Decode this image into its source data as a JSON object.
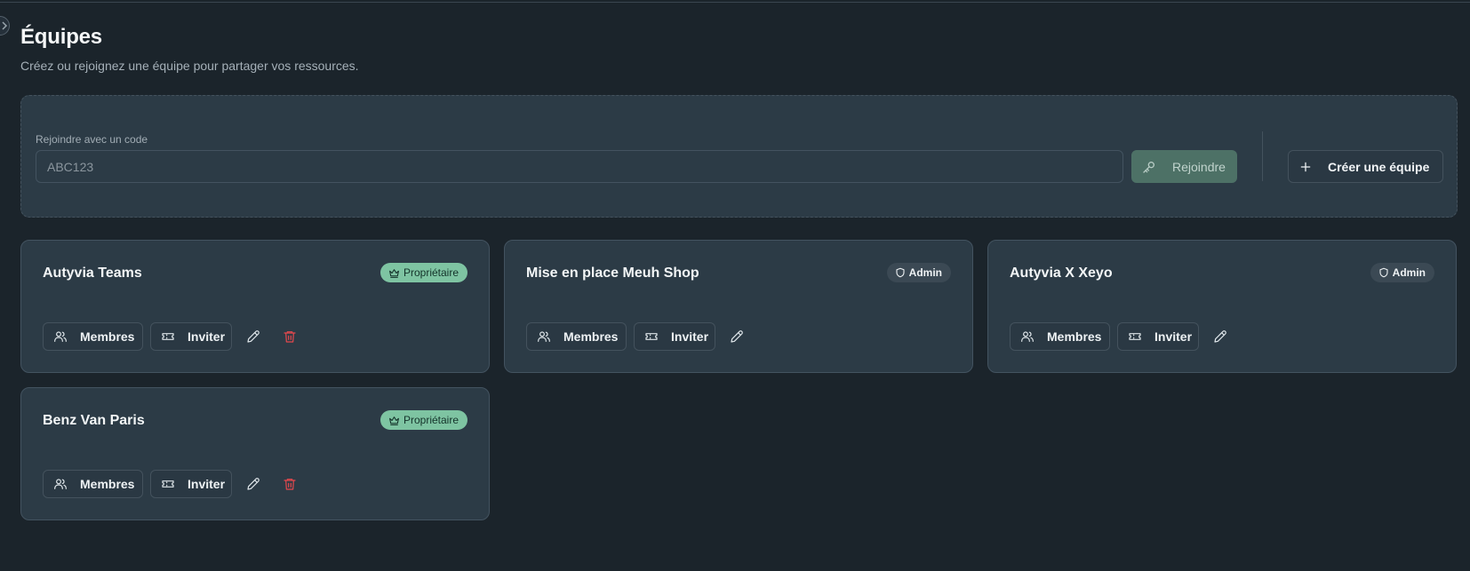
{
  "header": {
    "title": "Équipes",
    "subtitle": "Créez ou rejoignez une équipe pour partager vos ressources."
  },
  "join": {
    "label": "Rejoindre avec un code",
    "placeholder": "ABC123",
    "join_label": "Rejoindre",
    "create_label": "Créer une équipe"
  },
  "teams": [
    {
      "name": "Autyvia Teams",
      "role": "Propriétaire",
      "members_label": "Membres",
      "invite_label": "Inviter"
    },
    {
      "name": "Mise en place Meuh Shop",
      "role": "Admin",
      "members_label": "Membres",
      "invite_label": "Inviter"
    },
    {
      "name": "Autyvia X Xeyo",
      "role": "Admin",
      "members_label": "Membres",
      "invite_label": "Inviter"
    },
    {
      "name": "Benz Van Paris",
      "role": "Propriétaire",
      "members_label": "Membres",
      "invite_label": "Inviter"
    }
  ],
  "colors": {
    "background": "#1b242b",
    "panel": "#2c3b46",
    "accent": "#7ec4a2",
    "join_button": "#4d7166",
    "danger": "#e5484d"
  },
  "icons": {
    "join_button": "key-icon",
    "create_button": "plus-icon",
    "owner_badge": "crown-icon",
    "admin_badge": "shield-icon",
    "members": "users-icon",
    "invite": "ticket-icon",
    "edit": "pencil-icon",
    "delete": "trash-icon"
  }
}
